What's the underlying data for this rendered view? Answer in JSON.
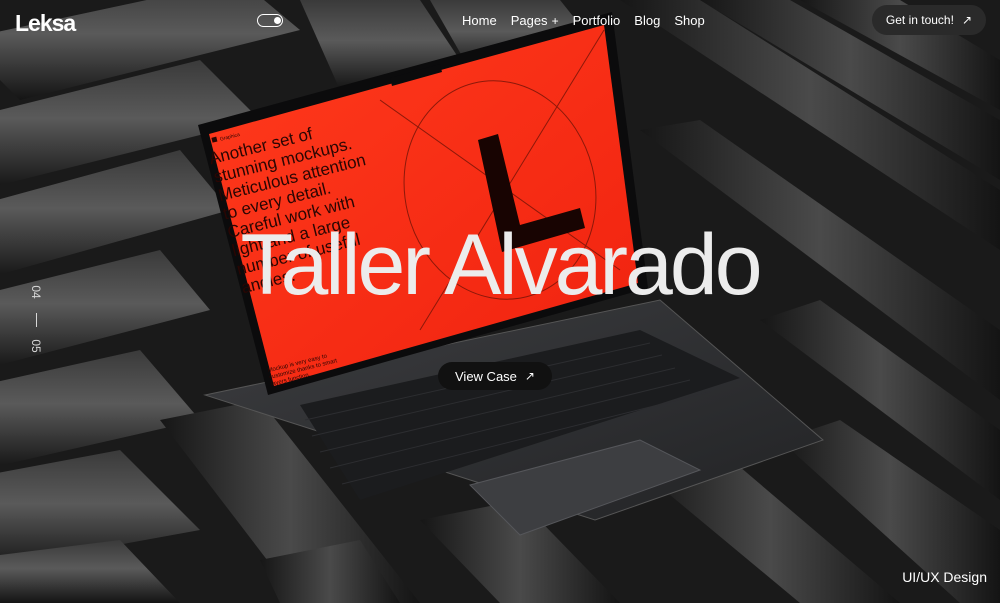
{
  "header": {
    "logo": "Leksa",
    "menu": [
      {
        "label": "Home"
      },
      {
        "label": "Pages",
        "suffix": "+"
      },
      {
        "label": "Portfolio"
      },
      {
        "label": "Blog"
      },
      {
        "label": "Shop"
      }
    ],
    "cta_label": "Get in touch!",
    "cta_icon": "arrow-up-right-icon",
    "theme_toggle": "toggle-icon"
  },
  "hero": {
    "title": "Taller Alvarado",
    "view_case_label": "View Case",
    "view_case_icon": "arrow-up-right-icon",
    "category": "UI/UX Design"
  },
  "slider": {
    "current": "04",
    "total": "05"
  },
  "mockup_screen": {
    "headline": [
      "Another set of",
      "stunning mockups.",
      "Meticulous attention",
      "to every detail.",
      "Careful work with",
      "light and a large",
      "number of useful",
      "angles."
    ],
    "small_text": [
      "Mockup is very easy to",
      "customize thanks to smart",
      "layers function."
    ],
    "big_letter": "L",
    "corner_label": "Graphica",
    "accent_color": "#ff2a14"
  },
  "colors": {
    "background": "#1c1c1c",
    "text": "#ffffff",
    "button_bg": "#2a2a2a"
  }
}
